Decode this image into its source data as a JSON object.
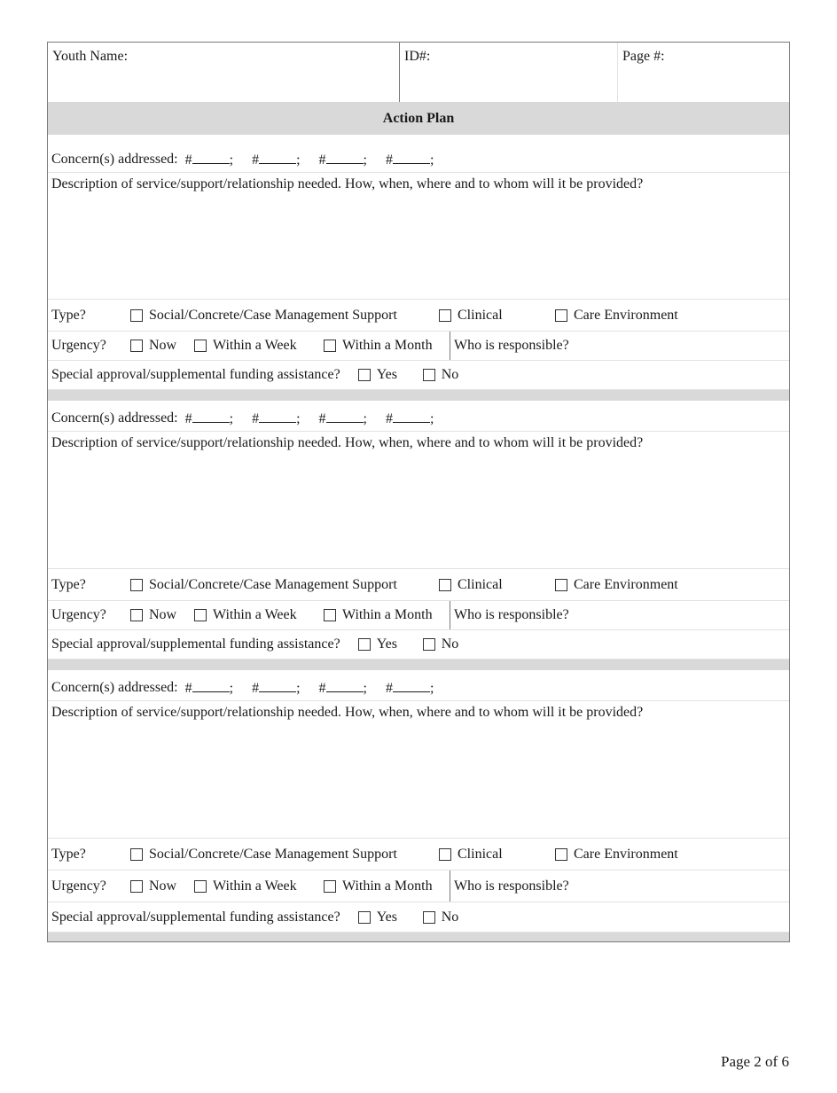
{
  "header": {
    "youth_name_label": "Youth Name:",
    "id_label": "ID#:",
    "page_label": "Page #:"
  },
  "title": "Action Plan",
  "sections": [
    {
      "concerns_label": "Concern(s) addressed:",
      "concern_prefix": "#",
      "concern_suffix": ";",
      "description_label": "Description of service/support/relationship needed. How, when, where and to whom will it be provided?",
      "type_label": "Type?",
      "type_options": [
        "Social/Concrete/Case Management Support",
        "Clinical",
        "Care Environment"
      ],
      "urgency_label": "Urgency?",
      "urgency_options": [
        "Now",
        "Within a Week",
        "Within a Month"
      ],
      "responsible_label": "Who is responsible?",
      "funding_label": "Special approval/supplemental funding assistance?",
      "funding_options": [
        "Yes",
        "No"
      ]
    },
    {
      "concerns_label": "Concern(s) addressed:",
      "concern_prefix": "#",
      "concern_suffix": ";",
      "description_label": "Description of service/support/relationship needed. How, when, where and to whom will it be provided?",
      "type_label": "Type?",
      "type_options": [
        "Social/Concrete/Case Management Support",
        "Clinical",
        "Care Environment"
      ],
      "urgency_label": "Urgency?",
      "urgency_options": [
        "Now",
        "Within a Week",
        "Within a Month"
      ],
      "responsible_label": "Who is responsible?",
      "funding_label": "Special approval/supplemental funding assistance?",
      "funding_options": [
        "Yes",
        "No"
      ]
    },
    {
      "concerns_label": "Concern(s) addressed:",
      "concern_prefix": "#",
      "concern_suffix": ";",
      "description_label": "Description of service/support/relationship needed. How, when, where and to whom will it be provided?",
      "type_label": "Type?",
      "type_options": [
        "Social/Concrete/Case Management Support",
        "Clinical",
        "Care Environment"
      ],
      "urgency_label": "Urgency?",
      "urgency_options": [
        "Now",
        "Within a Week",
        "Within a Month"
      ],
      "responsible_label": "Who is responsible?",
      "funding_label": "Special approval/supplemental funding assistance?",
      "funding_options": [
        "Yes",
        "No"
      ]
    }
  ],
  "footer": {
    "page_indicator": "Page 2 of 6"
  },
  "colors": {
    "section_band": "#d9d9d9",
    "border": "#7a7a7a",
    "text": "#1a1a1a"
  }
}
